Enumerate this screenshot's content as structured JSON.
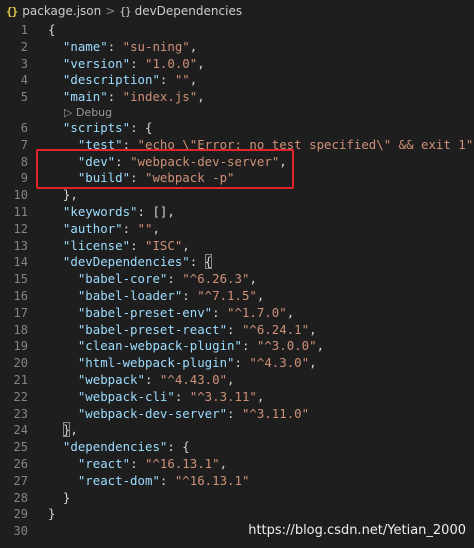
{
  "breadcrumb": {
    "file_icon": "{}",
    "file": "package.json",
    "separator": ">",
    "node_icon": "{}",
    "node": "devDependencies"
  },
  "codelens": "▷ Debug",
  "line_numbers": [
    "1",
    "2",
    "3",
    "4",
    "5",
    "6",
    "7",
    "8",
    "9",
    "10",
    "11",
    "12",
    "13",
    "14",
    "15",
    "16",
    "17",
    "18",
    "19",
    "20",
    "21",
    "22",
    "23",
    "24",
    "25",
    "26",
    "27",
    "28",
    "29",
    "30"
  ],
  "watermark": "https://blog.csdn.net/Yetian_2000",
  "colors": {
    "background": "#1e1e1e",
    "key": "#9cdcfe",
    "string": "#ce9178",
    "punctuation": "#d4d4d4",
    "line_number": "#858585",
    "highlight_box": "#e0242a"
  }
}
